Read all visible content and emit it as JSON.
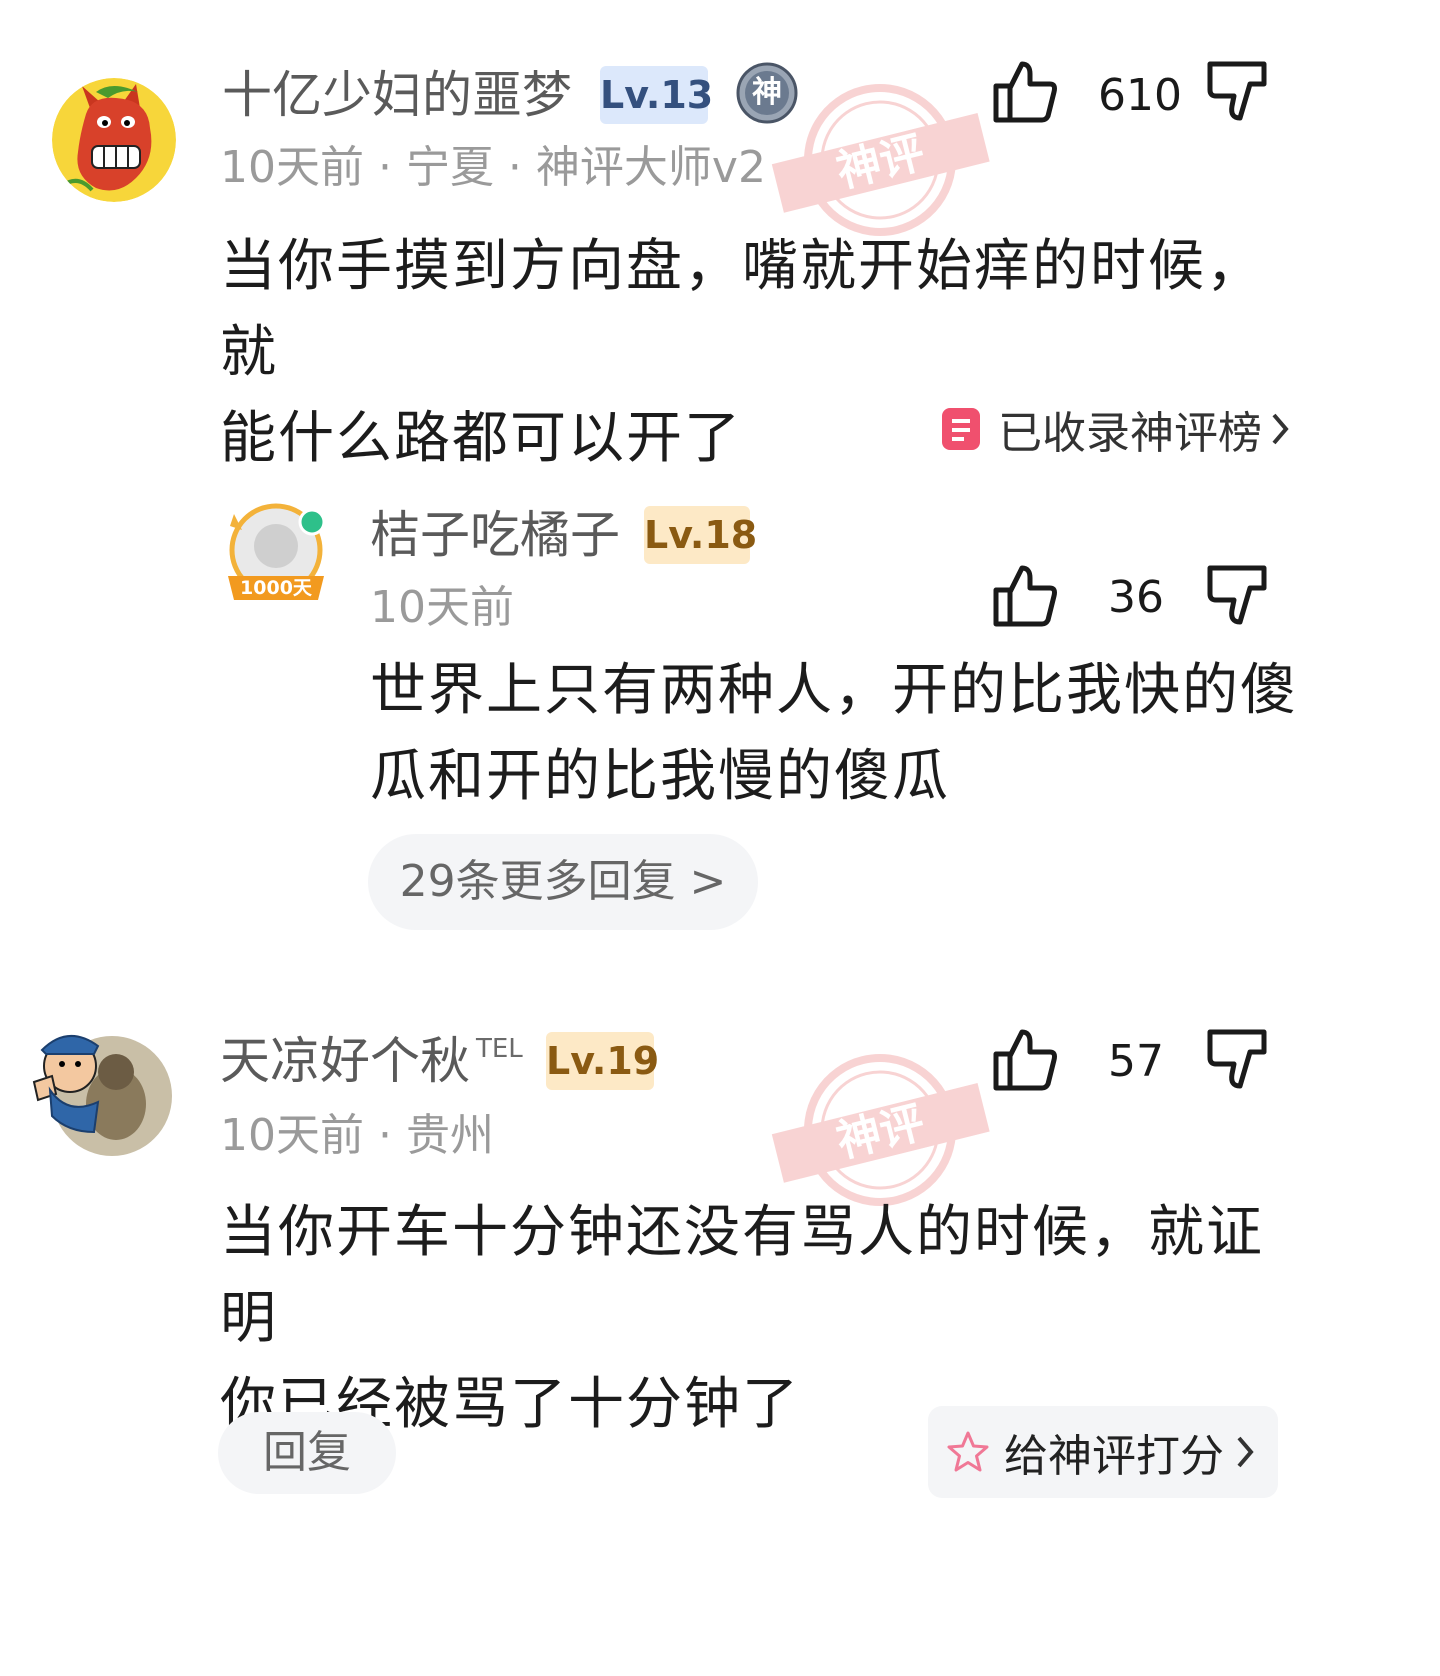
{
  "comments": [
    {
      "username": "十亿少妇的噩梦",
      "level": "Lv.13",
      "god_badge": "神",
      "meta": "10天前 · 宁夏 · 神评大师v2",
      "content_line1": "当你手摸到方向盘，嘴就开始痒的时候，就",
      "content_line2": "能什么路都可以开了",
      "likes": "610",
      "stamp_text": "神评",
      "collected_label": "已收录神评榜",
      "reply": {
        "username": "桔子吃橘子",
        "level": "Lv.18",
        "avatar_badge": "1000天",
        "meta": "10天前",
        "likes": "36",
        "content_line1": "世界上只有两种人，开的比我快的傻",
        "content_line2": "瓜和开的比我慢的傻瓜"
      },
      "more_replies_label": "29条更多回复 >"
    },
    {
      "username": "天凉好个秋",
      "name_superscript": "TEL",
      "level": "Lv.19",
      "meta": "10天前 · 贵州",
      "content_line1": "当你开车十分钟还没有骂人的时候，就证明",
      "content_line2": "你已经被骂了十分钟了",
      "likes": "57",
      "stamp_text": "神评",
      "reply_label": "回复",
      "rate_label": "给神评打分"
    }
  ],
  "colors": {
    "level_blue_bg": "#dce8fb",
    "level_gold_bg": "#fde9c6",
    "stamp_red": "#e23c3c",
    "collected_icon": "#f0506e",
    "star_pink": "#f07896"
  },
  "icons": [
    "thumbs-up-icon",
    "thumbs-down-icon",
    "list-icon",
    "chevron-right-icon",
    "star-icon"
  ]
}
